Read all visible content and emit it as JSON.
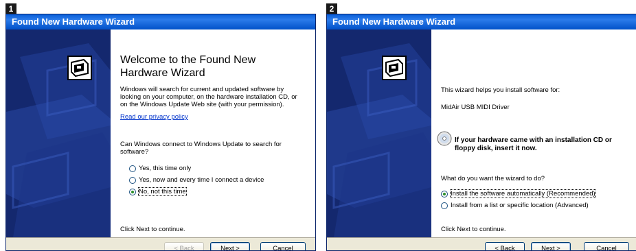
{
  "steps": [
    {
      "badge": "1",
      "title": "Found New Hardware Wizard",
      "heading": "Welcome to the Found New Hardware Wizard",
      "intro": "Windows will search for current and updated software by looking on your computer, on the hardware installation CD, or on the Windows Update Web site (with your permission).",
      "privacy_link": "Read our privacy policy",
      "question": "Can Windows connect to Windows Update to search for software?",
      "options": [
        {
          "label": "Yes, this time only",
          "checked": false
        },
        {
          "label": "Yes, now and every time I connect a device",
          "checked": false
        },
        {
          "label": "No, not this time",
          "checked": true
        }
      ],
      "footer": "Click Next to continue.",
      "buttons": {
        "back": "< Back",
        "next": "Next >",
        "cancel": "Cancel"
      }
    },
    {
      "badge": "2",
      "title": "Found New Hardware Wizard",
      "intro": "This wizard helps you install software for:",
      "device": "MidAir USB MIDI Driver",
      "cd_note": "If your hardware came with an installation CD or floppy disk, insert it now.",
      "question": "What do you want the wizard to do?",
      "options": [
        {
          "label": "Install the software automatically (Recommended)",
          "checked": true
        },
        {
          "label": "Install from a list or specific location (Advanced)",
          "checked": false
        }
      ],
      "footer": "Click Next to continue.",
      "buttons": {
        "back": "< Back",
        "next": "Next >",
        "cancel": "Cancel"
      }
    }
  ],
  "icons": {
    "hardware": "hardware-card-icon",
    "cd": "cd-icon",
    "radio_selected": "radio-selected"
  },
  "colors": {
    "titlebar": "#0a5fd8",
    "banner": "#14286e",
    "dialog_bg": "#ece9d8",
    "link": "#0033cc"
  }
}
